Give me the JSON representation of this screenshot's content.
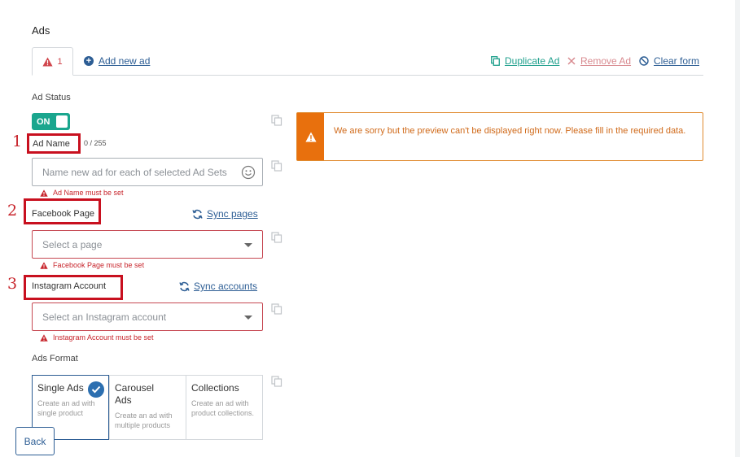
{
  "page": {
    "title": "Ads"
  },
  "tabs": {
    "active_count": "1"
  },
  "actions": {
    "add_new": "Add new ad",
    "duplicate": "Duplicate Ad",
    "remove": "Remove Ad",
    "clear": "Clear form"
  },
  "ad_status": {
    "label": "Ad Status",
    "toggle": "ON"
  },
  "ad_name": {
    "label": "Ad Name",
    "counter": "0 / 255",
    "placeholder": "Name new ad for each of selected Ad Sets",
    "error": "Ad Name must be set"
  },
  "facebook_page": {
    "label": "Facebook Page",
    "sync": "Sync pages",
    "placeholder": "Select a page",
    "error": "Facebook Page must be set"
  },
  "instagram": {
    "label": "Instagram Account",
    "sync": "Sync accounts",
    "placeholder": "Select an Instagram account",
    "error": "Instagram Account must be set"
  },
  "annotations": {
    "one": "1",
    "two": "2",
    "three": "3"
  },
  "preview_alert": {
    "message": "We are sorry but the preview can't be displayed right now. Please fill in the required data."
  },
  "ads_format": {
    "label": "Ads Format",
    "options": [
      {
        "title": "Single Ads",
        "desc": "Create an ad with single product",
        "selected": true
      },
      {
        "title": "Carousel Ads",
        "desc": "Create an ad with multiple products",
        "selected": false
      },
      {
        "title": "Collections",
        "desc": "Create an ad with product collections.",
        "selected": false
      }
    ]
  },
  "footer": {
    "back": "Back"
  },
  "colors": {
    "accent": "#2c5d94",
    "toggle_on": "#1aa68e",
    "error": "#c8262d",
    "warning": "#e8700d",
    "annotation_box": "#c8101f"
  }
}
